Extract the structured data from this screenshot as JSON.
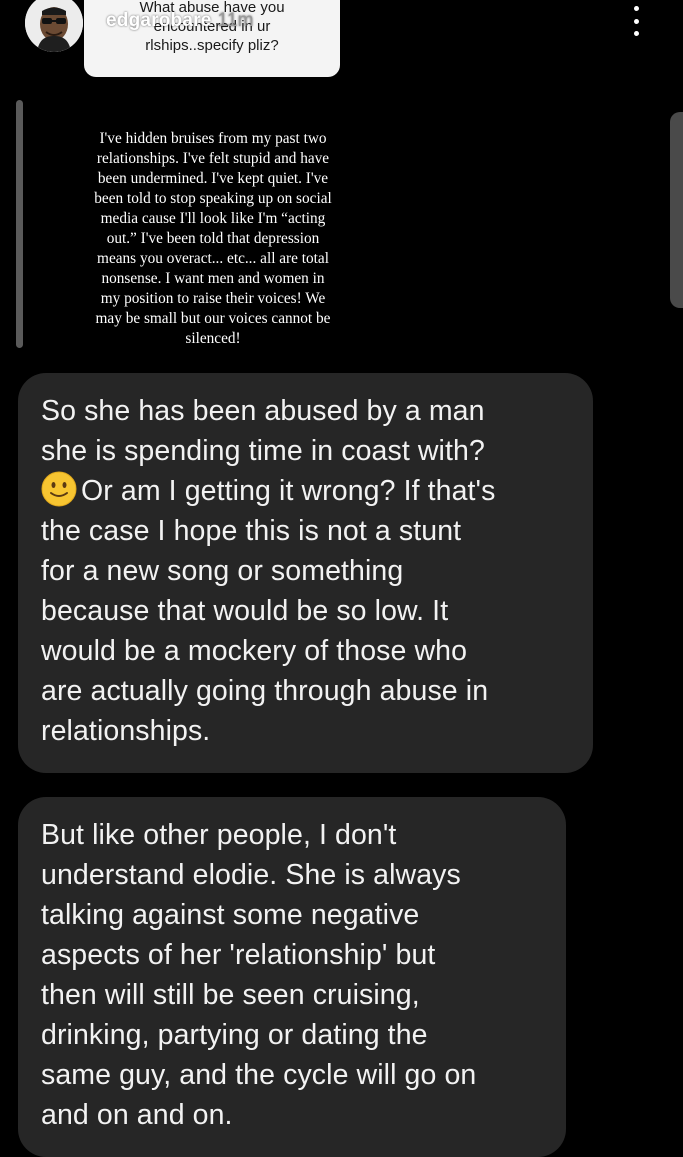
{
  "story": {
    "username": "edgarobare",
    "timestamp": "11m",
    "question_sticker": {
      "line1": "What abuse have you",
      "line2": "encountered in ur",
      "line3": "rlships..specify pliz?"
    },
    "text_lines": [
      "I've hidden bruises from my past two",
      "relationships. I've felt stupid and have",
      "been undermined. I've kept quiet. I've",
      "been told to stop speaking up on social",
      "media cause I'll look like I'm “acting",
      "out.” I've been told that depression",
      "means you overact... etc... all are total",
      "nonsense. I want men and women in",
      "my position to raise their voices! We",
      "may be small but our voices cannot be",
      "silenced!"
    ]
  },
  "messages": [
    {
      "lines": [
        "So she has been abused by a man",
        "she is spending time in coast with?",
        "Or am I getting it wrong? If that's",
        "the case I hope this is not a stunt",
        "for a new song or something",
        "because that would be so low. It",
        "would be a mockery of those who",
        "are actually going through abuse in",
        "relationships."
      ],
      "emoji": "slightly-smiling-face-icon"
    },
    {
      "lines": [
        "But like other people, I don't",
        "understand elodie. She is always",
        "talking against some negative",
        "aspects of her 'relationship' but",
        "then will still be seen cruising,",
        "drinking, partying or dating the",
        "same guy, and the cycle will go on",
        "and on and on."
      ]
    }
  ],
  "colors": {
    "background": "#000000",
    "bubble": "#262626",
    "sticker": "#f4f4f4"
  }
}
